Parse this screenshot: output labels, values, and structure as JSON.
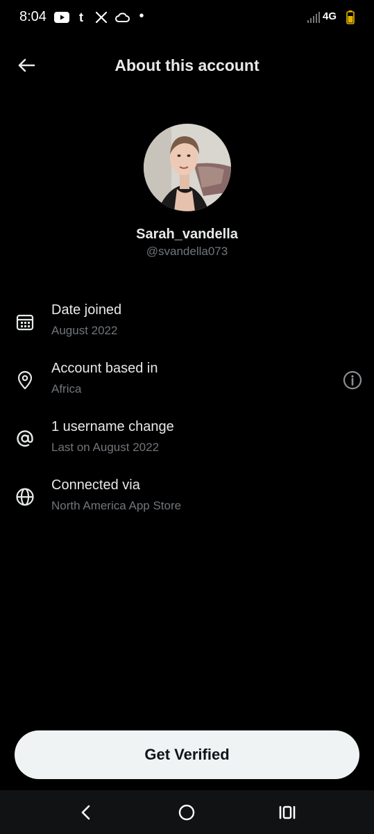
{
  "status_bar": {
    "time": "8:04",
    "network": "4G",
    "icons": [
      "youtube-icon",
      "tumblr-icon",
      "x-icon",
      "cloud-icon",
      "dot-icon",
      "signal-icon",
      "battery-icon"
    ]
  },
  "header": {
    "title": "About this account",
    "back_icon": "arrow-left-icon"
  },
  "profile": {
    "display_name": "Sarah_vandella",
    "handle": "@svandella073"
  },
  "info_rows": [
    {
      "icon": "calendar-icon",
      "title": "Date joined",
      "subtitle": "August 2022"
    },
    {
      "icon": "location-pin-icon",
      "title": "Account based in",
      "subtitle": "Africa",
      "action_icon": "info-icon"
    },
    {
      "icon": "at-sign-icon",
      "title": "1 username change",
      "subtitle": "Last on August 2022"
    },
    {
      "icon": "globe-icon",
      "title": "Connected via",
      "subtitle": "North America App Store"
    }
  ],
  "cta": {
    "label": "Get Verified"
  },
  "nav_bar": {
    "icons": [
      "nav-back-icon",
      "nav-home-icon",
      "nav-recents-icon"
    ]
  },
  "colors": {
    "background": "#000000",
    "primary_text": "#e7e9ea",
    "secondary_text": "#71767b",
    "button_bg": "#eff3f4",
    "button_text": "#0f1419"
  }
}
